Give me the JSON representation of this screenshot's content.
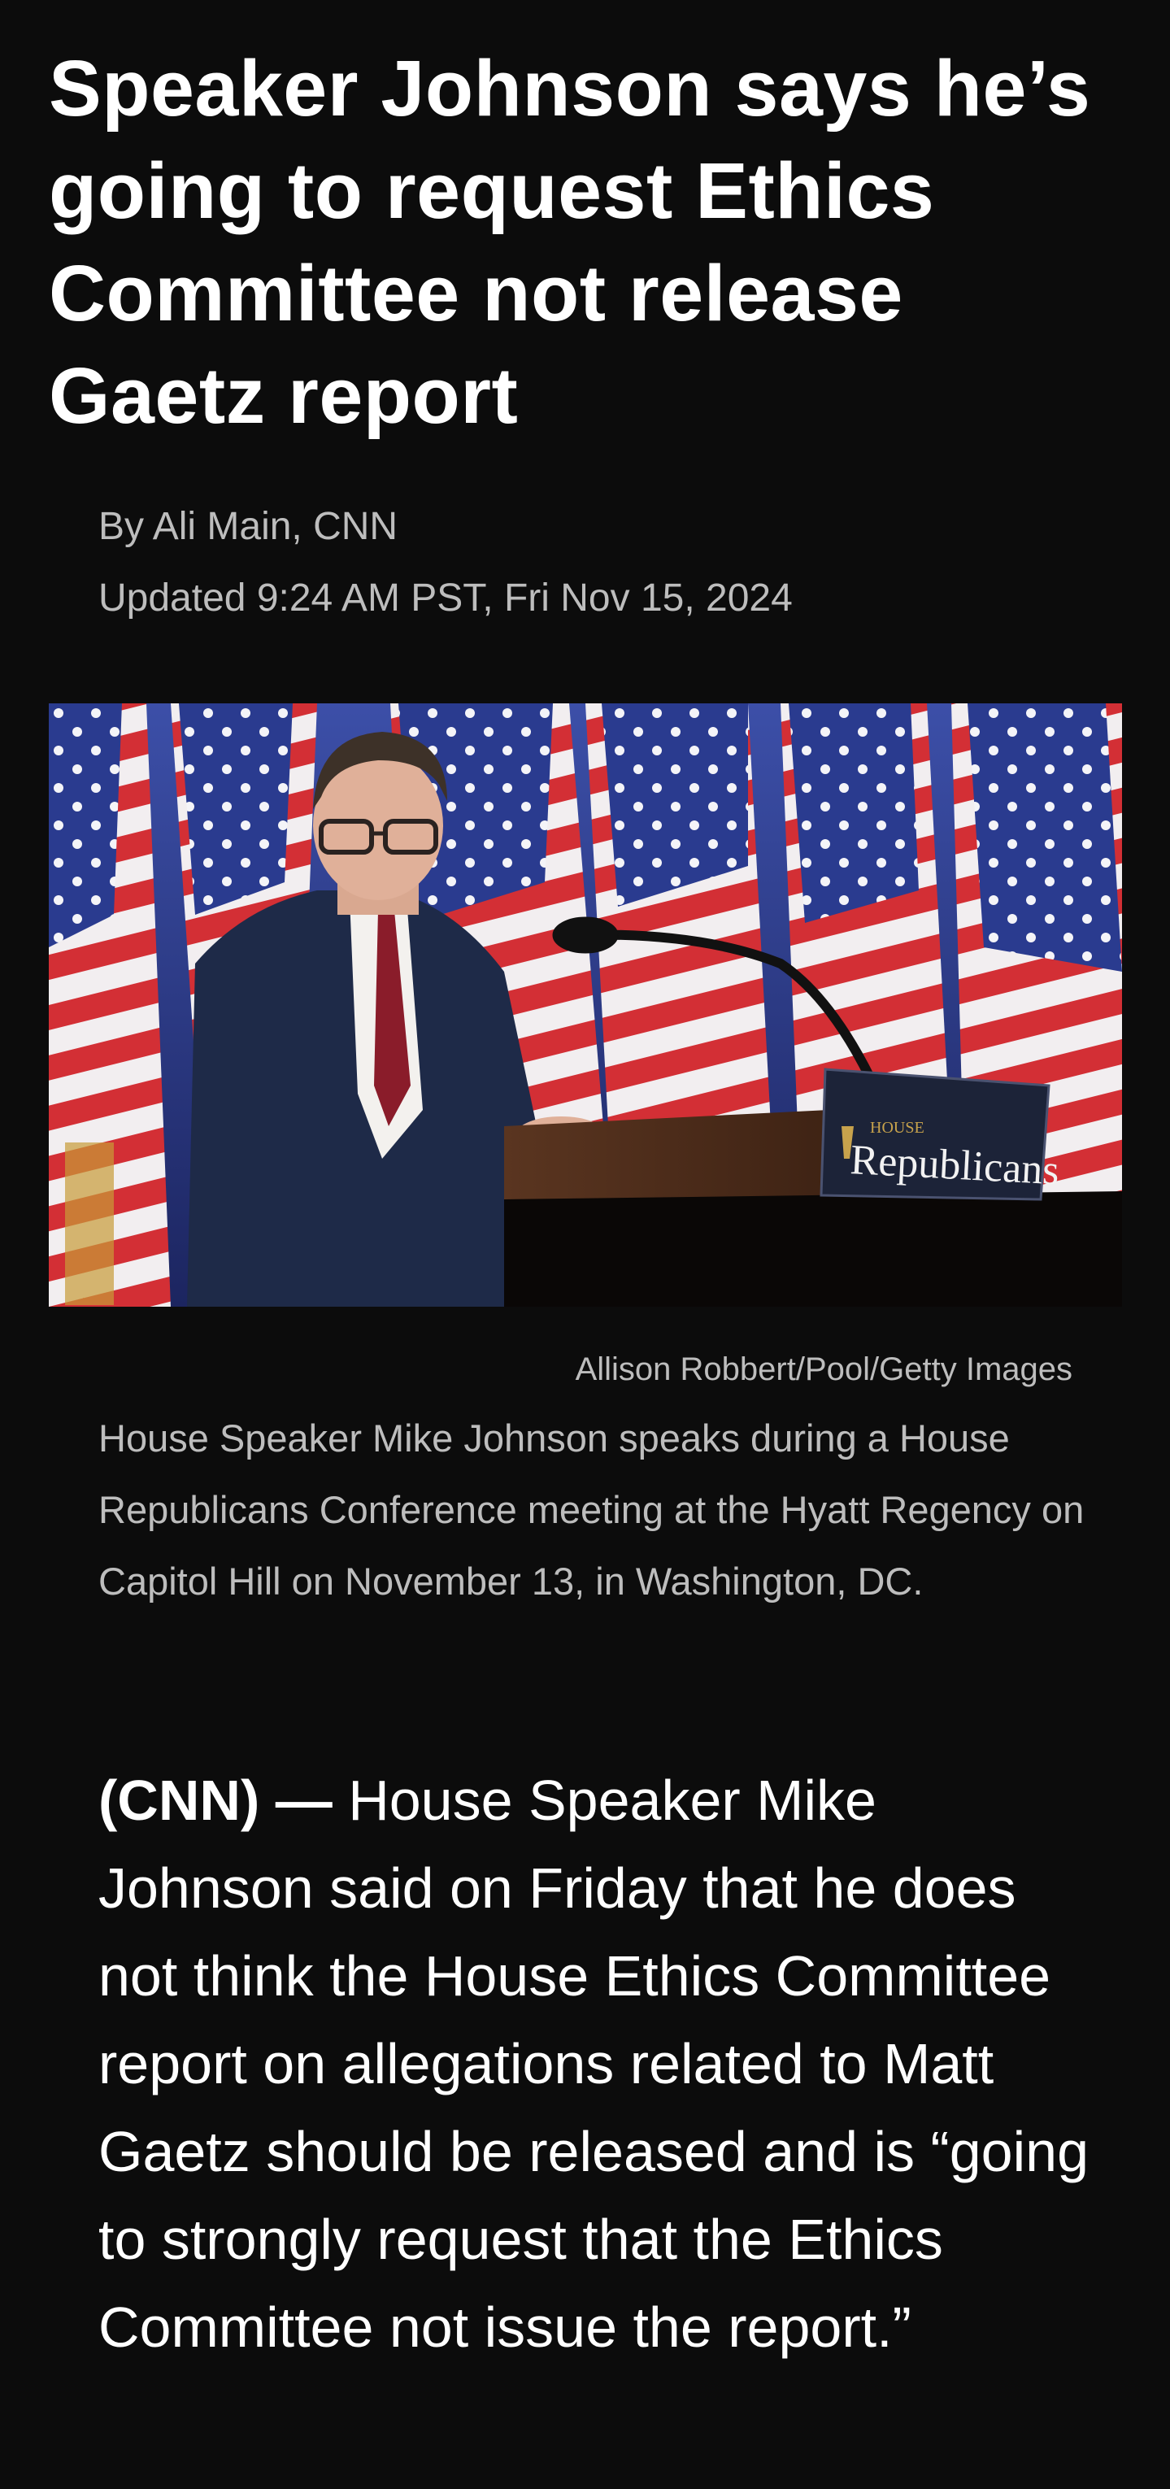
{
  "article": {
    "headline": "Speaker Johnson says he’s going to request Ethics Committee not release Gaetz report",
    "byline": "By Ali Main, CNN",
    "timestamp": "Updated 9:24 AM PST, Fri Nov 15, 2024",
    "image": {
      "podium_sign_small": "HOUSE",
      "podium_sign_large": "Republicans",
      "credit": "Allison Robbert/Pool/Getty Images",
      "caption": "House Speaker Mike Johnson speaks during a House Republicans Conference meeting at the Hyatt Regency on Capitol Hill on November 13, in Washington, DC."
    },
    "body": {
      "dateline": "(CNN) —",
      "lead": "House Speaker Mike Johnson said on Friday that he does not think the House Ethics Committee report on allegations related to Matt Gaetz should be released and is “going to strongly request that the Ethics Committee not issue the report.”"
    }
  },
  "colors": {
    "background": "#0c0c0c",
    "headline": "#ffffff",
    "meta_text": "#bdbdbd",
    "body_text": "#ffffff"
  }
}
